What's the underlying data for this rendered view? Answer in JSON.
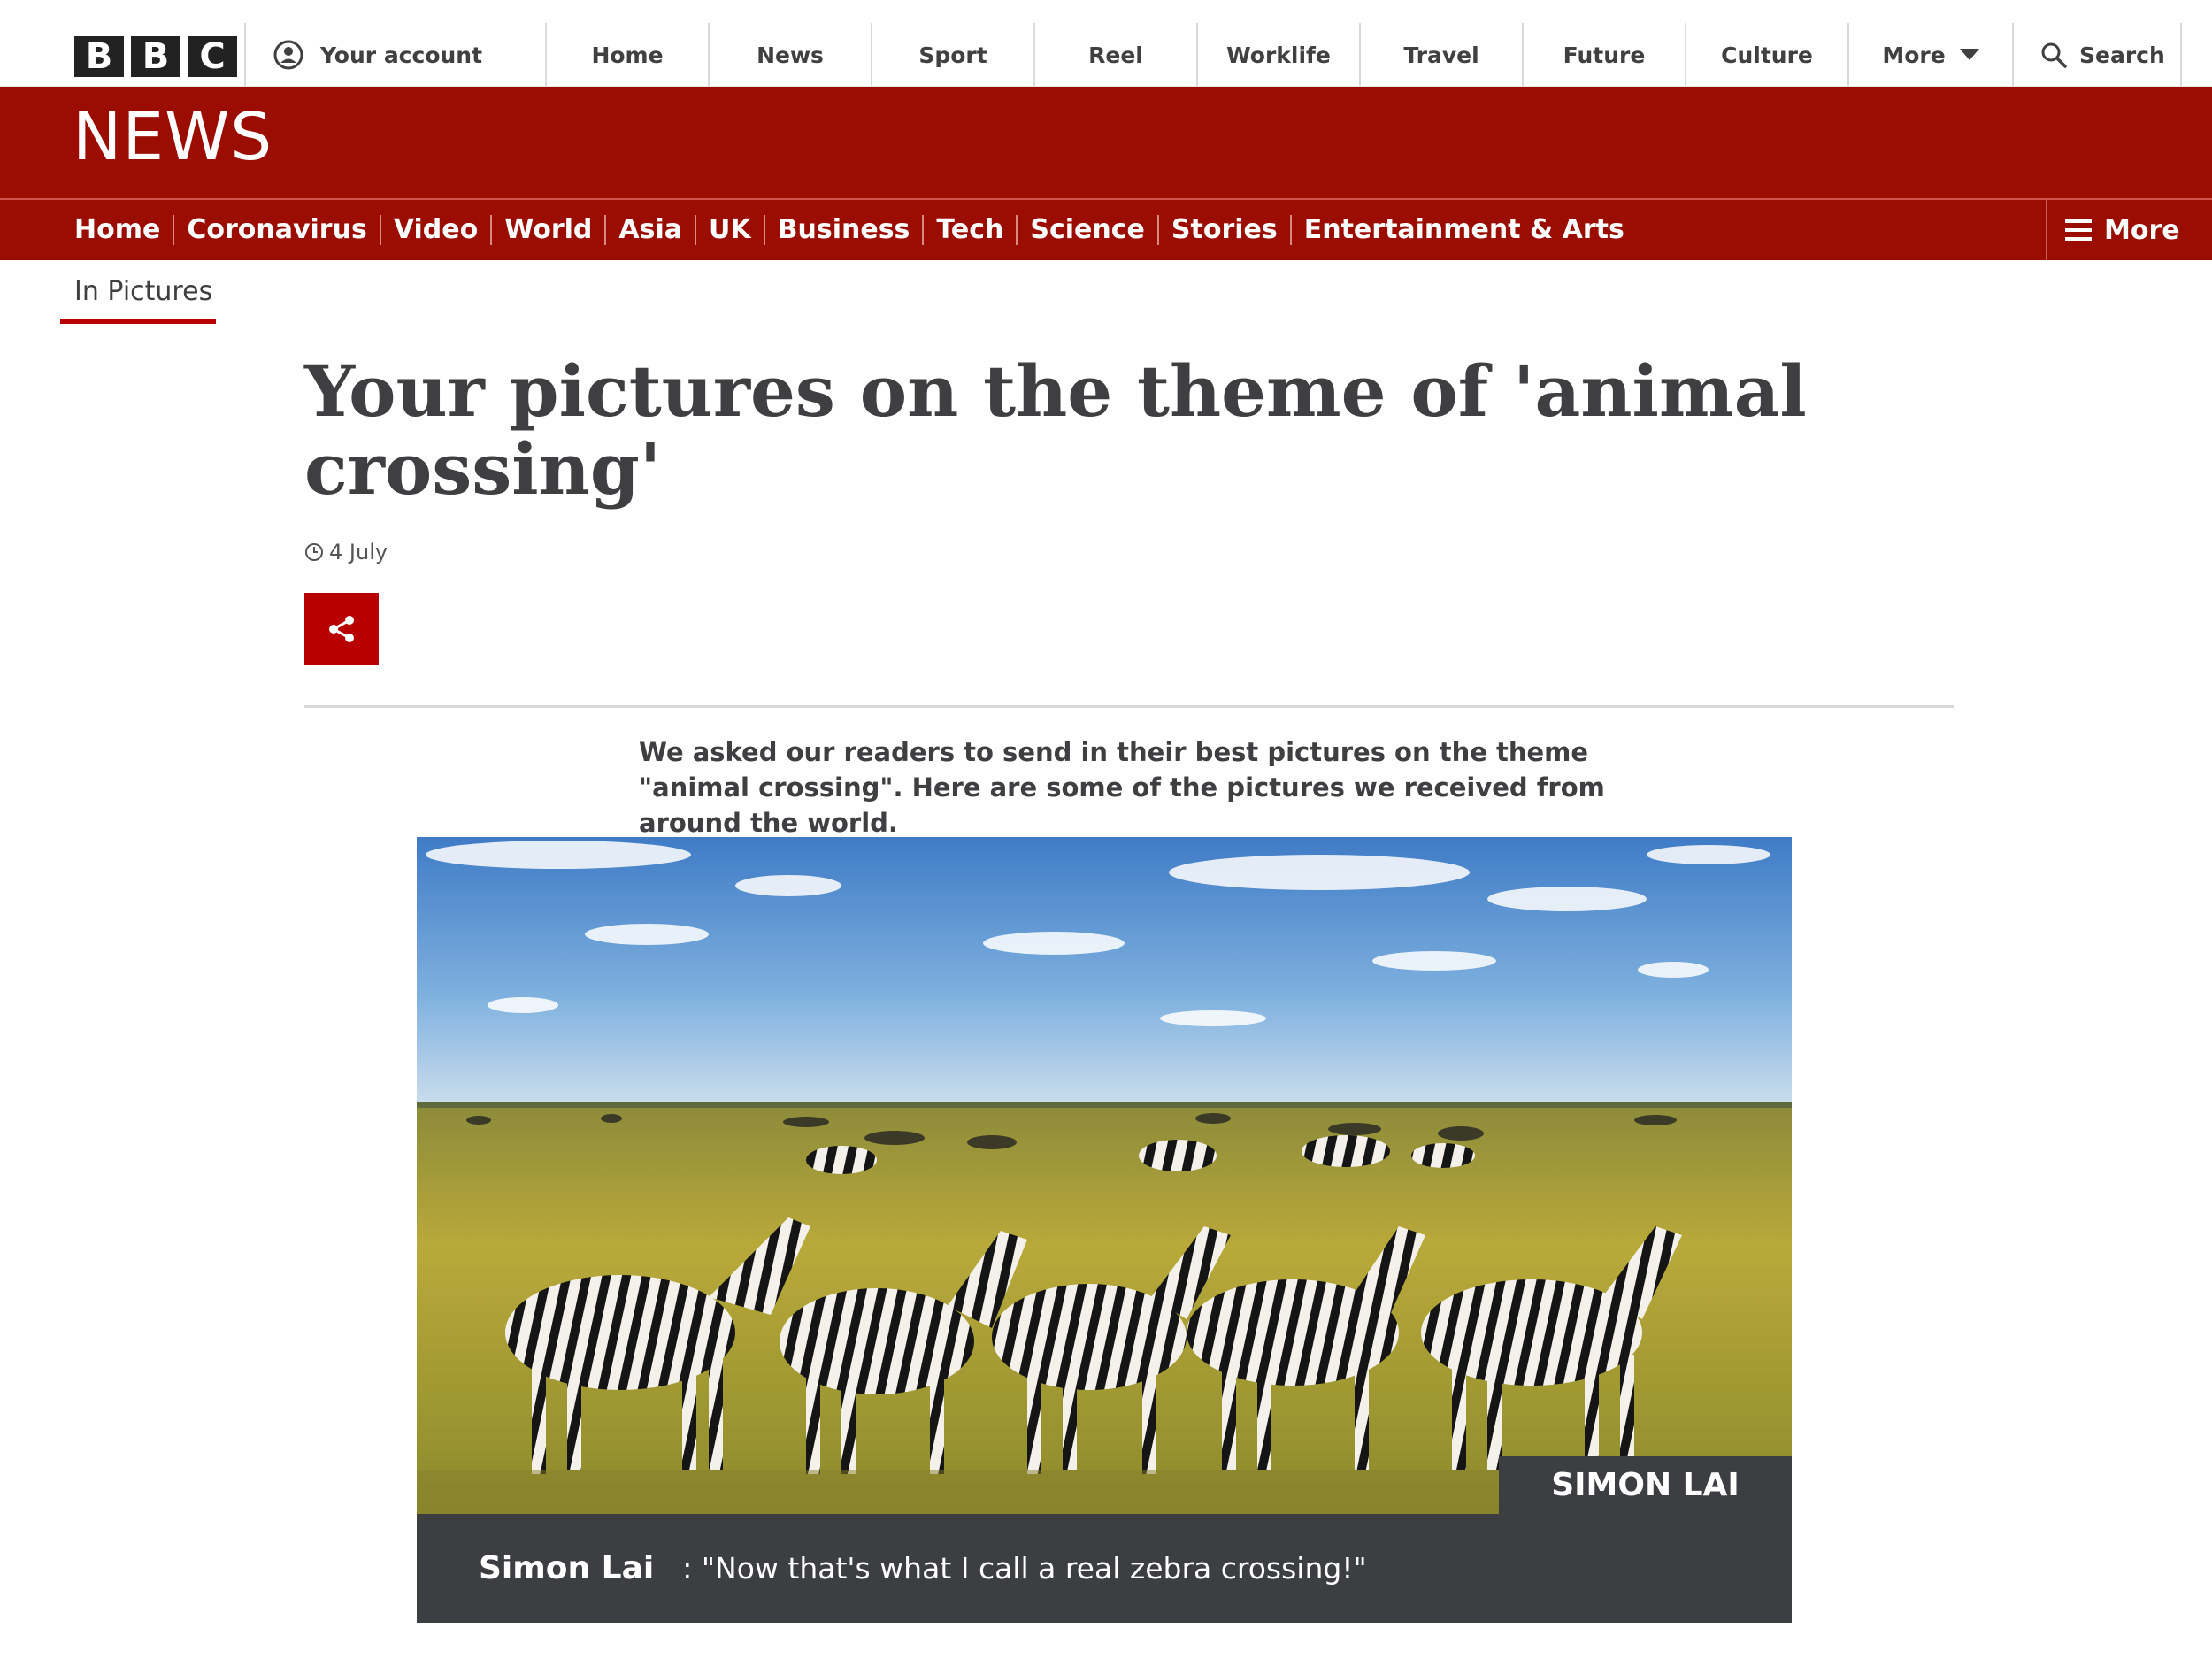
{
  "topbar": {
    "logo_letters": [
      "B",
      "B",
      "C"
    ],
    "account_label": "Your account",
    "nav": [
      "Home",
      "News",
      "Sport",
      "Reel",
      "Worklife",
      "Travel",
      "Future",
      "Culture",
      "More"
    ],
    "search_label": "Search"
  },
  "masthead": {
    "title": "NEWS",
    "nav": [
      "Home",
      "Coronavirus",
      "Video",
      "World",
      "Asia",
      "UK",
      "Business",
      "Tech",
      "Science",
      "Stories",
      "Entertainment & Arts"
    ],
    "more_label": "More",
    "accent_color": "#9b0c01"
  },
  "article": {
    "section": "In Pictures",
    "headline": "Your pictures on the theme of 'animal crossing'",
    "date": "4 July",
    "share_icon": "share-icon",
    "intro": "We asked our readers to send in their best pictures on the theme \"animal crossing\". Here are some of the pictures we received from around the world.",
    "photo": {
      "credit": "SIMON LAI",
      "caption_name": "Simon Lai",
      "caption_text": ": \"Now that's what I call a real zebra crossing!\""
    }
  }
}
